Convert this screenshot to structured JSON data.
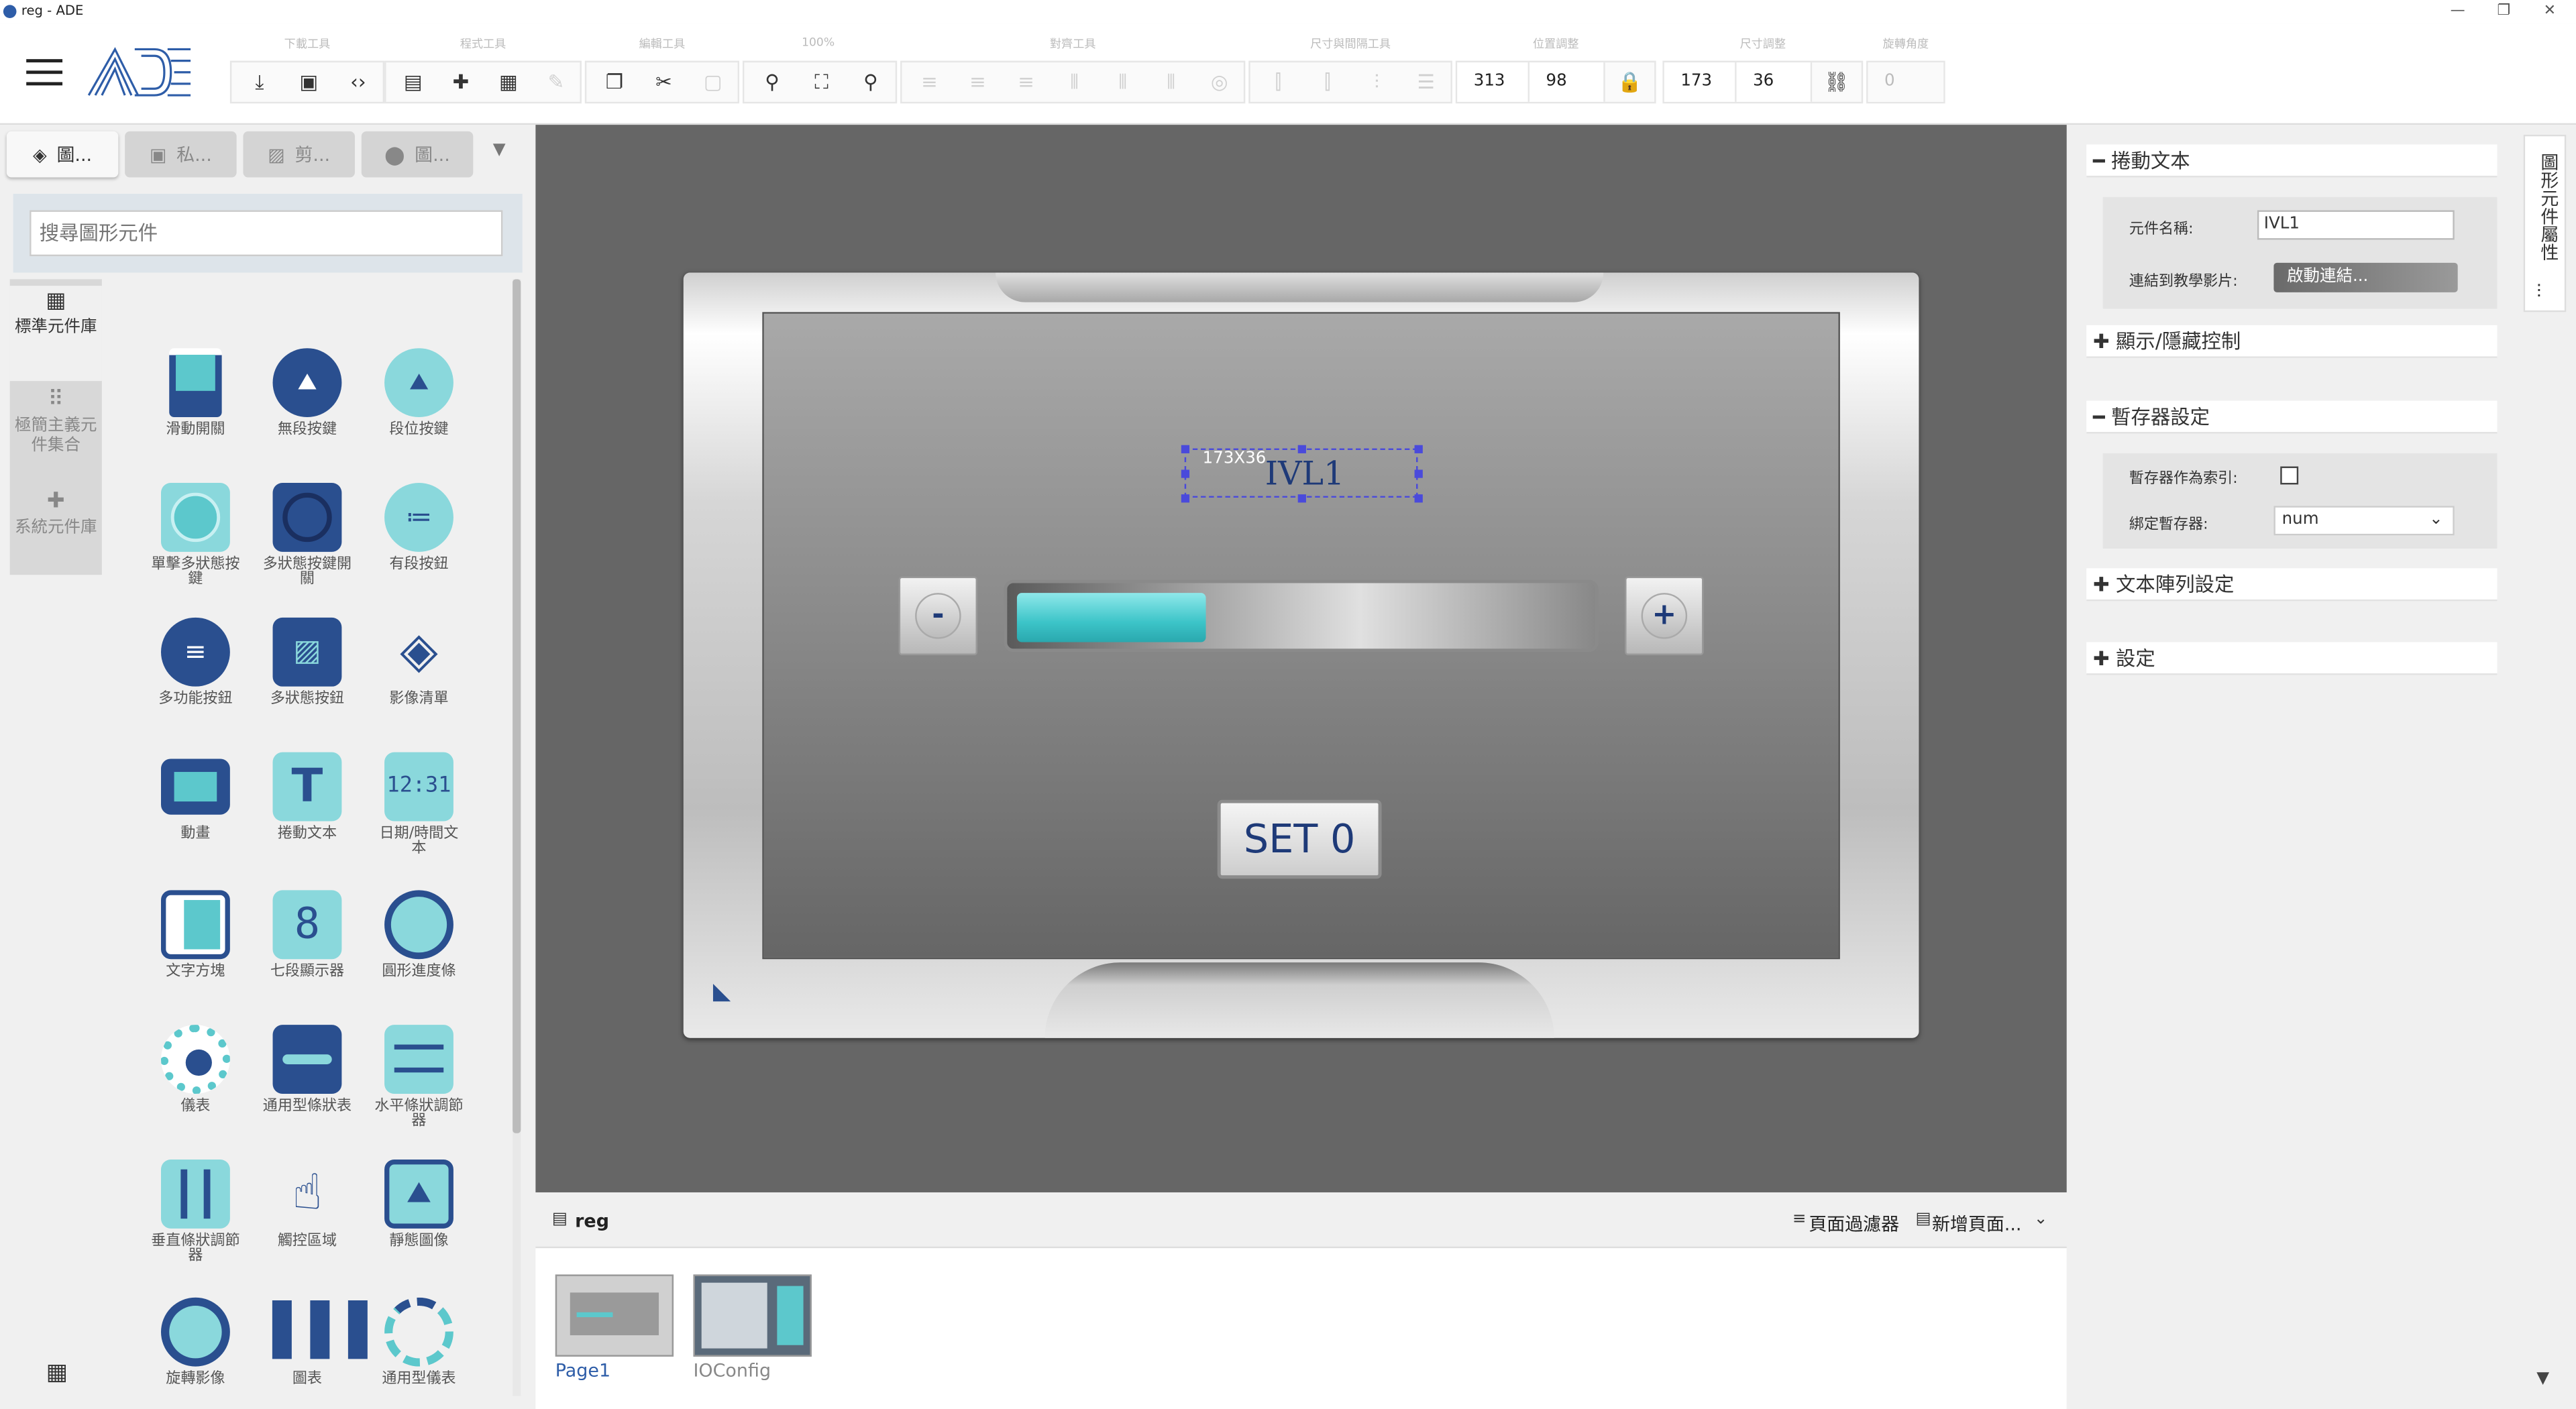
{
  "window": {
    "title": "reg - ADE",
    "controls": [
      "—",
      "❐",
      "✕"
    ]
  },
  "toolbar": {
    "groups": [
      {
        "label": "下載工具"
      },
      {
        "label": "程式工具"
      },
      {
        "label": "編輯工具"
      },
      {
        "label": "100%"
      },
      {
        "label": "對齊工具"
      },
      {
        "label": "尺寸與間隔工具"
      },
      {
        "label": "位置調整"
      },
      {
        "label": "尺寸調整"
      },
      {
        "label": "旋轉角度"
      }
    ],
    "pos_x": "313",
    "pos_y": "98",
    "size_w": "173",
    "size_h": "36",
    "rotation": "0"
  },
  "left_panel": {
    "tabs": [
      "圖...",
      "私...",
      "剪...",
      "圖..."
    ],
    "search_placeholder": "搜尋圖形元件",
    "categories": [
      "標準元件庫",
      "極簡主義元件集合",
      "系統元件庫"
    ],
    "components": [
      "滑動開關",
      "無段按鍵",
      "段位按鍵",
      "單擊多狀態按鍵",
      "多狀態按鍵開關",
      "有段按鈕",
      "多功能按鈕",
      "多狀態按鈕",
      "影像清單",
      "動畫",
      "捲動文本",
      "日期/時間文本",
      "文字方塊",
      "七段顯示器",
      "圓形進度條",
      "儀表",
      "通用型條狀表",
      "水平條狀調節器",
      "垂直條狀調節器",
      "觸控區域",
      "靜態圖像",
      "旋轉影像",
      "圖表",
      "通用型儀表"
    ]
  },
  "canvas": {
    "selection_size": "173X36",
    "text_element": "IVL1",
    "minus": "-",
    "plus": "+",
    "set_button": "SET 0",
    "slider_fill": 0.32
  },
  "page_bar": {
    "title": "reg",
    "filter": "頁面過濾器",
    "new_page": "新增頁面...",
    "pages": [
      "Page1",
      "IOConfig"
    ]
  },
  "right_panel": {
    "vertical_tab": "圖形元件屬性",
    "sections": [
      "捲動文本",
      "顯示/隱藏控制",
      "暫存器設定",
      "文本陣列設定",
      "設定"
    ],
    "component_name_label": "元件名稱:",
    "component_name": "IVL1",
    "tutorial_label": "連結到教學影片:",
    "tutorial_button": "啟動連結...",
    "register_index_label": "暫存器作為索引:",
    "bind_register_label": "綁定暫存器:",
    "bind_register_value": "num"
  },
  "colors": {
    "accent": "#2e5da8",
    "teal": "#5cc8cc",
    "navy": "#2a4f8f",
    "canvas_bg": "#666666"
  }
}
